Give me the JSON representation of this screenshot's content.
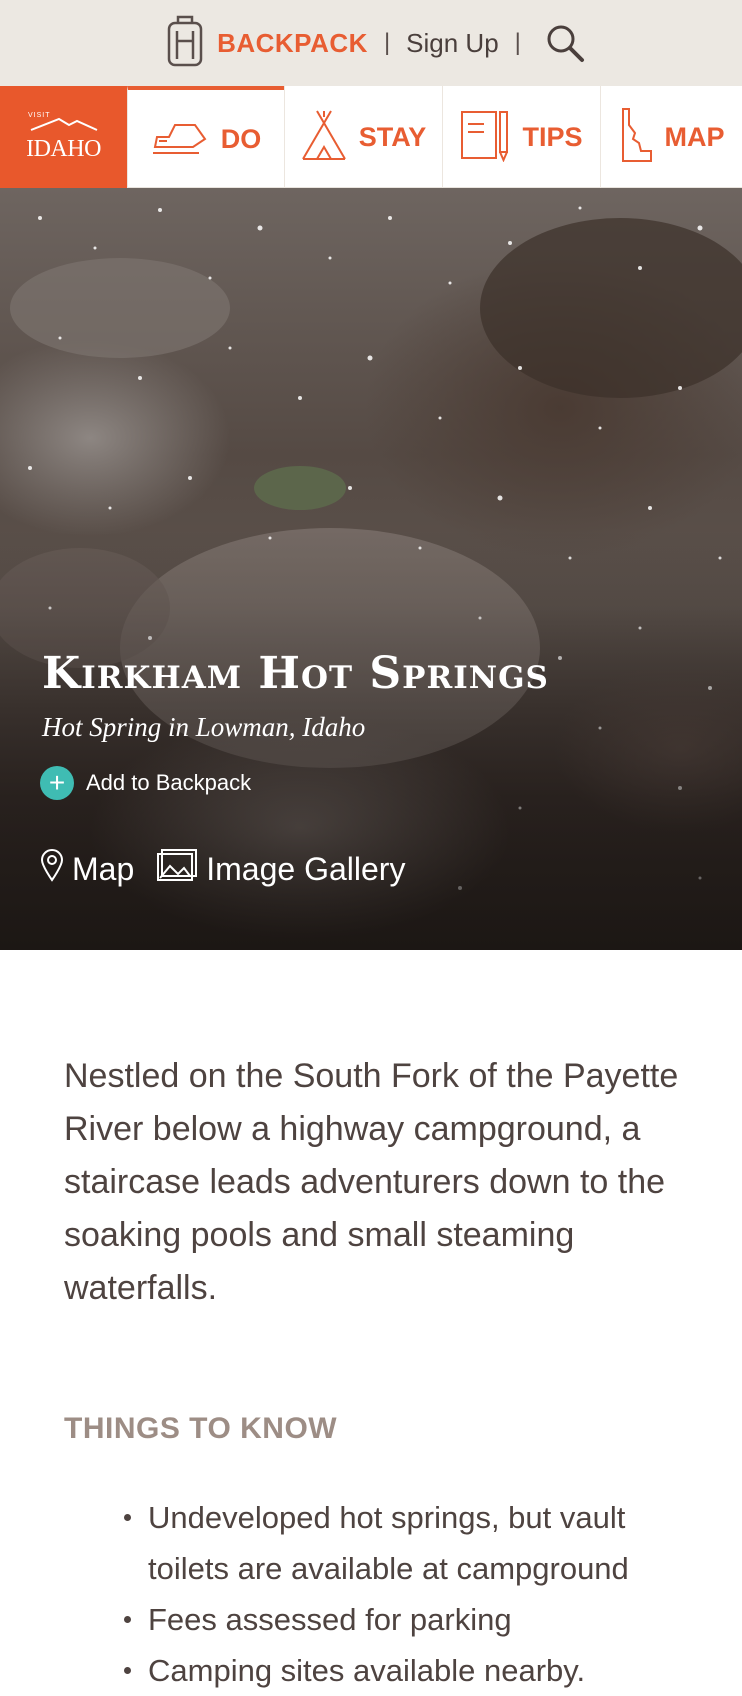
{
  "topbar": {
    "backpack_label": "BACKPACK",
    "separator": "|",
    "signup_label": "Sign Up"
  },
  "logo": {
    "visit": "VISIT",
    "idaho": "IDAHO"
  },
  "nav": {
    "items": [
      {
        "label": "DO",
        "icon": "snowmobile-icon"
      },
      {
        "label": "STAY",
        "icon": "tent-icon"
      },
      {
        "label": "TIPS",
        "icon": "notebook-pencil-icon"
      },
      {
        "label": "MAP",
        "icon": "idaho-outline-icon"
      }
    ]
  },
  "hero": {
    "title": "Kirkham Hot Springs",
    "subtitle": "Hot Spring in Lowman, Idaho",
    "add_label": "Add to Backpack",
    "map_label": "Map",
    "gallery_label": "Image Gallery"
  },
  "content": {
    "description": "Nestled on the South Fork of the Payette River below a highway campground, a staircase leads adventurers down to the soaking pools and small steaming waterfalls.",
    "things_heading": "THINGS TO KNOW",
    "things": [
      "Undeveloped hot springs, but vault toilets are available at campground",
      "Fees assessed for parking",
      "Camping sites available nearby."
    ]
  },
  "colors": {
    "brand_orange": "#e85d32",
    "topbar_bg": "#ece8e2",
    "teal": "#3fbcb3",
    "heading_taupe": "#9d8d85"
  }
}
